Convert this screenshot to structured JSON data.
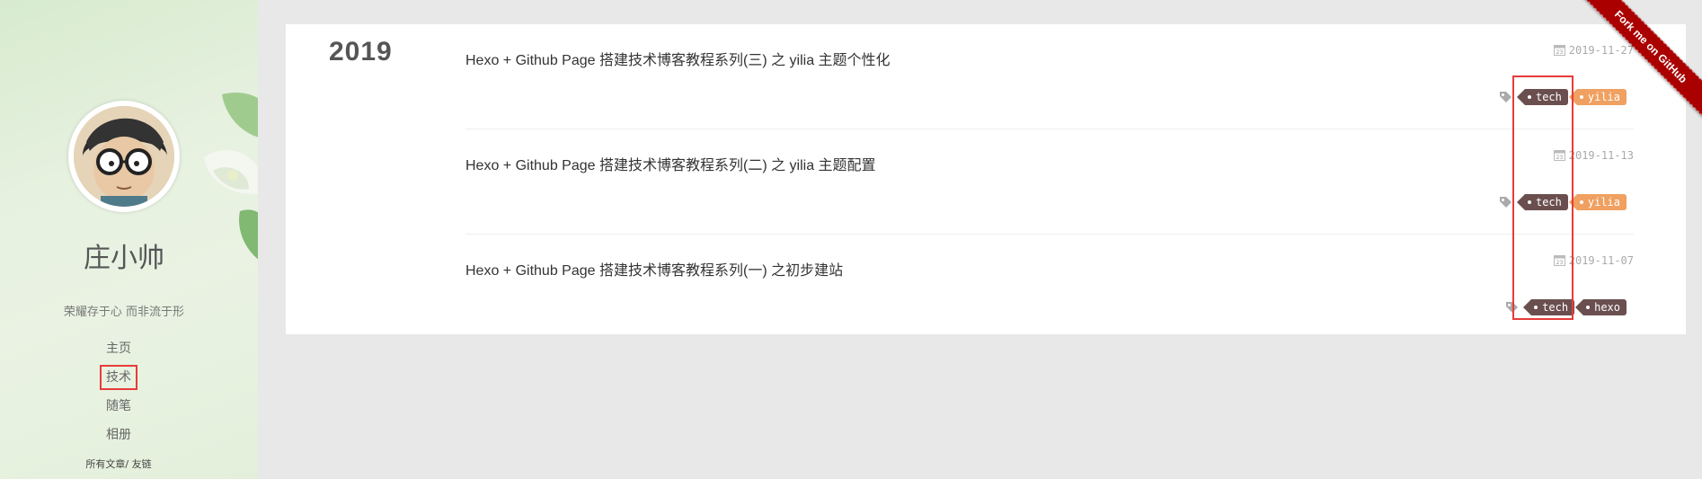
{
  "sidebar": {
    "site_name": "庄小帅",
    "motto": "荣耀存于心 而非流于形",
    "nav": [
      {
        "label": "主页"
      },
      {
        "label": "技术"
      },
      {
        "label": "随笔"
      },
      {
        "label": "相册"
      }
    ],
    "sub_links": {
      "all_posts": "所有文章",
      "separator": "/",
      "friends": "友链"
    }
  },
  "archive": {
    "year": "2019",
    "posts": [
      {
        "title": "Hexo + Github Page 搭建技术博客教程系列(三) 之 yilia 主题个性化",
        "date": "2019-11-27",
        "tags": [
          "tech",
          "yilia"
        ]
      },
      {
        "title": "Hexo + Github Page 搭建技术博客教程系列(二) 之 yilia 主题配置",
        "date": "2019-11-13",
        "tags": [
          "tech",
          "yilia"
        ]
      },
      {
        "title": "Hexo + Github Page 搭建技术博客教程系列(一) 之初步建站",
        "date": "2019-11-07",
        "tags": [
          "tech",
          "hexo"
        ]
      }
    ]
  },
  "ribbon": {
    "label": "Fork me on GitHub"
  },
  "colors": {
    "tag_dark": "#6b4f4f",
    "tag_orange": "#f0a060",
    "ribbon": "#aa0000",
    "highlight": "#e83b3b"
  }
}
